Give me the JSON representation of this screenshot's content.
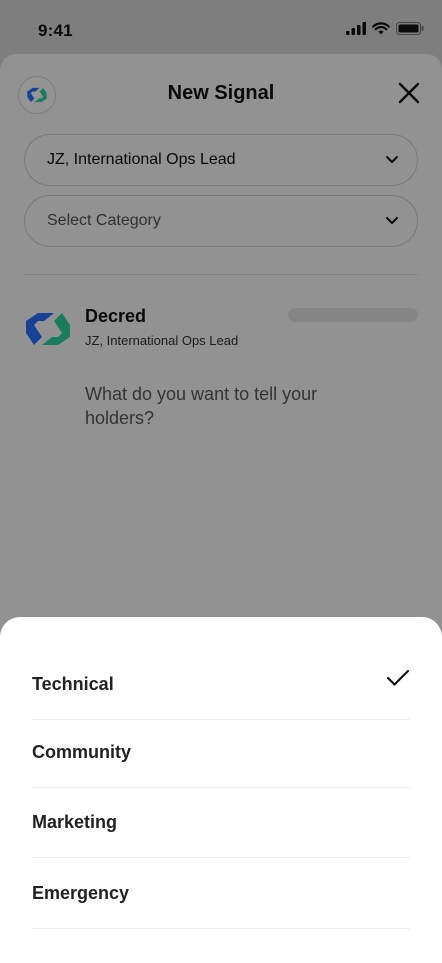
{
  "status_bar": {
    "time": "9:41"
  },
  "header": {
    "title": "New Signal"
  },
  "author_select": {
    "value": "JZ, International Ops Lead"
  },
  "category_select": {
    "placeholder": "Select Category"
  },
  "post": {
    "name": "Decred",
    "role": "JZ, International Ops Lead",
    "placeholder": "What do you want to tell your holders?"
  },
  "category_sheet": {
    "options": [
      {
        "label": "Technical",
        "selected": true
      },
      {
        "label": "Community",
        "selected": false
      },
      {
        "label": "Marketing",
        "selected": false
      },
      {
        "label": "Emergency",
        "selected": false
      }
    ]
  },
  "colors": {
    "brand_blue": "#2970ff",
    "brand_green": "#2ed6a1",
    "overlay": "#000000"
  }
}
